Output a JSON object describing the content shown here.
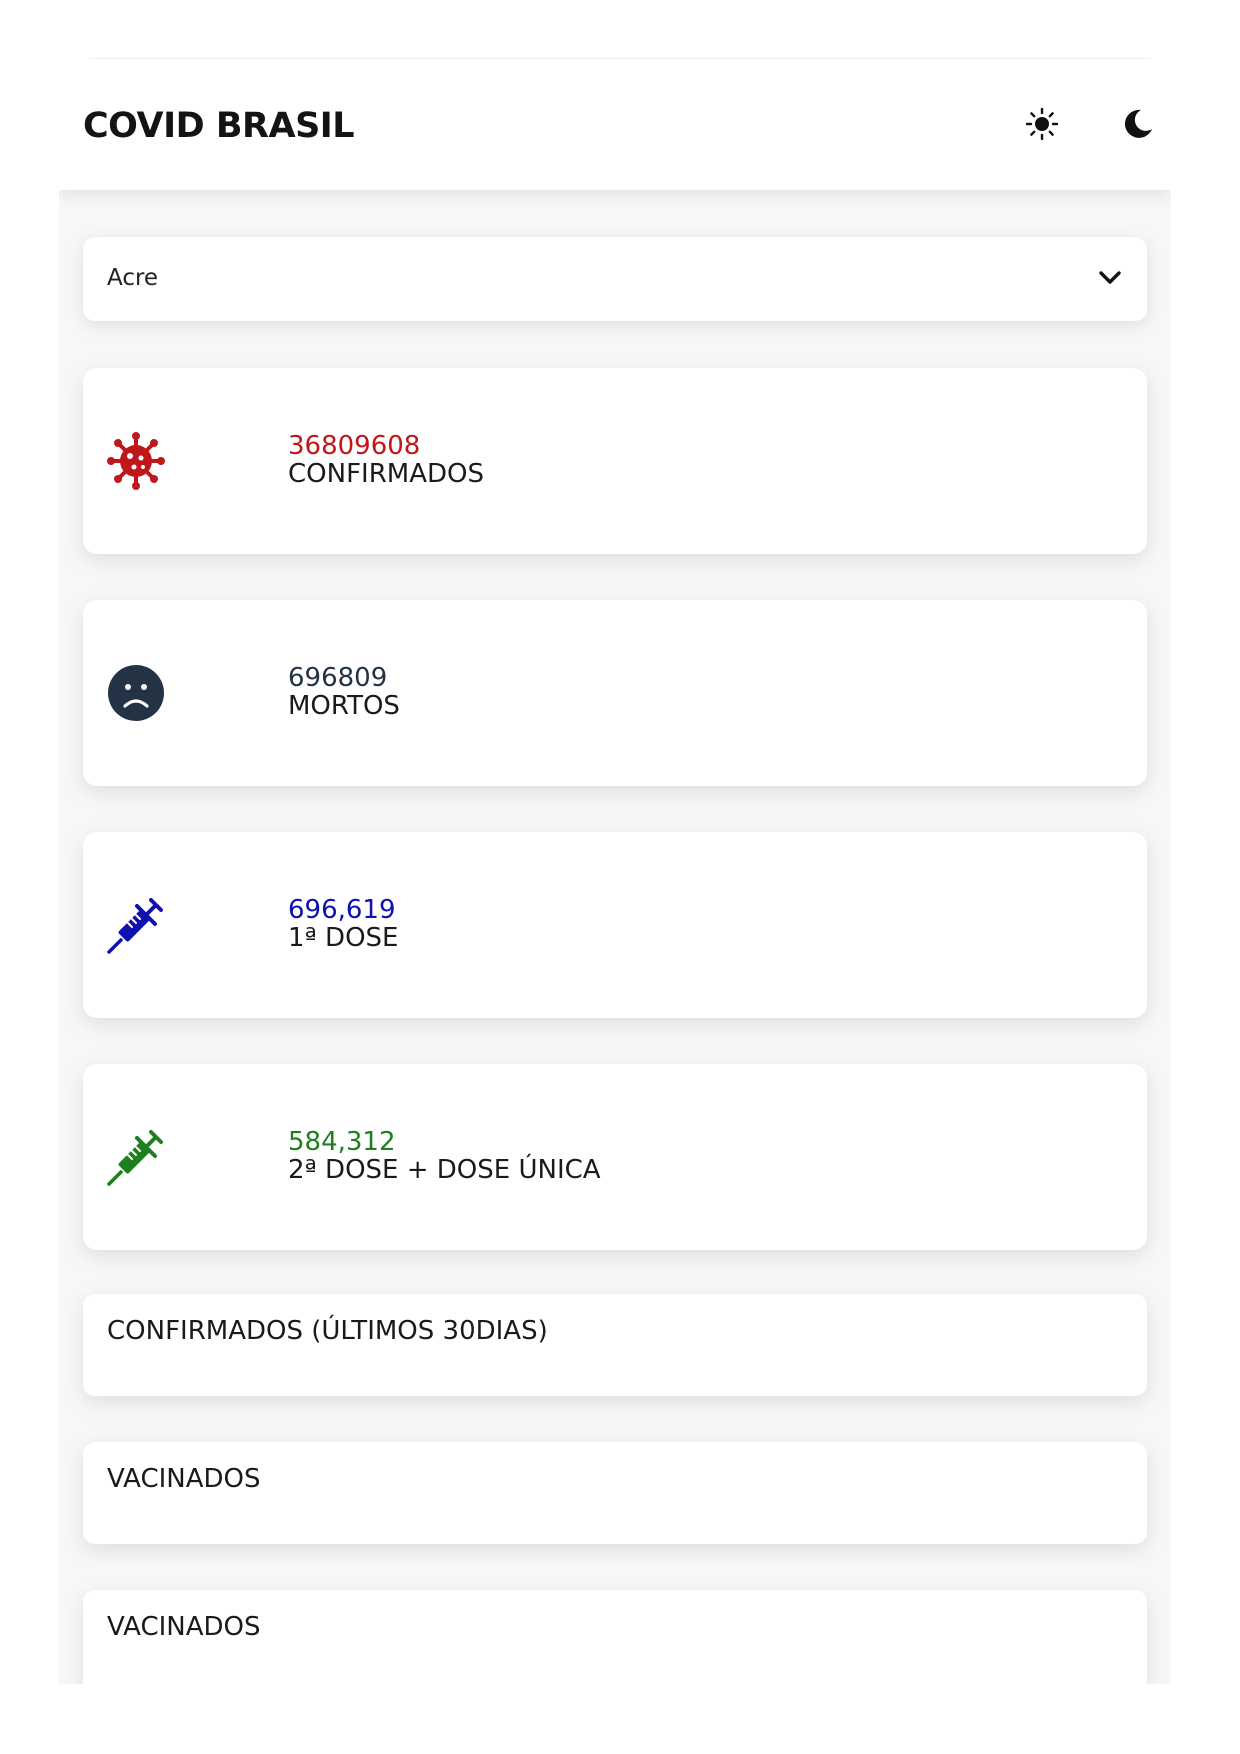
{
  "header": {
    "title": "COVID BRASIL",
    "light_icon": "sun-icon",
    "dark_icon": "moon-icon"
  },
  "state_select": {
    "value": "Acre",
    "icon": "chevron-down-icon"
  },
  "cards": [
    {
      "number": "36809608",
      "label": "CONFIRMADOS",
      "icon": "virus-icon",
      "color": "#c0171b"
    },
    {
      "number": "696809",
      "label": "MORTOS",
      "icon": "sad-face-icon",
      "color": "#233244"
    },
    {
      "number": "696,619",
      "label": "1ª DOSE",
      "icon": "syringe-icon",
      "color": "#1010b0"
    },
    {
      "number": "584,312",
      "label": "2ª DOSE + DOSE ÚNICA",
      "icon": "syringe-icon",
      "color": "#1e7f1e"
    }
  ],
  "sections": [
    {
      "title": "CONFIRMADOS (ÚLTIMOS 30DIAS)"
    },
    {
      "title": "VACINADOS"
    },
    {
      "title": "VACINADOS"
    }
  ]
}
